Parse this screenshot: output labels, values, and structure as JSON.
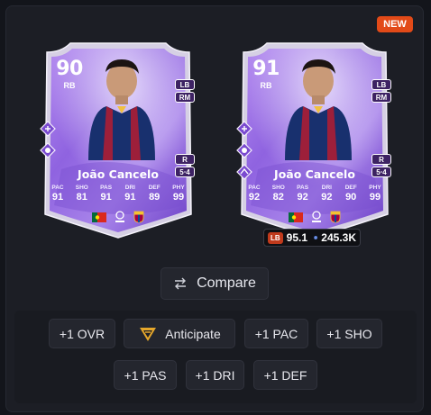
{
  "new_badge": "NEW",
  "cards": [
    {
      "rating": "90",
      "position": "RB",
      "alt_positions": [
        "LB",
        "RM"
      ],
      "foot": "R",
      "skills_weakfoot": "5⋅4",
      "name": "João Cancelo",
      "stats": [
        {
          "label": "PAC",
          "value": "91"
        },
        {
          "label": "SHO",
          "value": "81"
        },
        {
          "label": "PAS",
          "value": "91"
        },
        {
          "label": "DRI",
          "value": "91"
        },
        {
          "label": "DEF",
          "value": "89"
        },
        {
          "label": "PHY",
          "value": "99"
        }
      ]
    },
    {
      "rating": "91",
      "position": "RB",
      "alt_positions": [
        "LB",
        "RM"
      ],
      "foot": "R",
      "skills_weakfoot": "5⋅4",
      "name": "João Cancelo",
      "stats": [
        {
          "label": "PAC",
          "value": "92"
        },
        {
          "label": "SHO",
          "value": "82"
        },
        {
          "label": "PAS",
          "value": "92"
        },
        {
          "label": "DRI",
          "value": "92"
        },
        {
          "label": "DEF",
          "value": "90"
        },
        {
          "label": "PHY",
          "value": "99"
        }
      ]
    }
  ],
  "price_row": {
    "position_badge": "LB",
    "rating": "95.1",
    "price": "245.3K"
  },
  "compare_label": "Compare",
  "boosts": [
    "+1 OVR",
    "Anticipate",
    "+1 PAC",
    "+1 SHO",
    "+1 PAS",
    "+1 DRI",
    "+1 DEF"
  ],
  "colors": {
    "background": "#13151b",
    "panel": "#1c1e25",
    "chip": "#24262e",
    "new_badge": "#e24a18",
    "card_purple": "#9b6fe0",
    "card_frame": "#d8d2e6"
  },
  "icons": [
    "playstyle-plus-icon",
    "compare-arrows-icon",
    "anticipate-icon",
    "portugal-flag-icon",
    "laliga-icon",
    "barcelona-crest-icon",
    "coin-icon"
  ]
}
